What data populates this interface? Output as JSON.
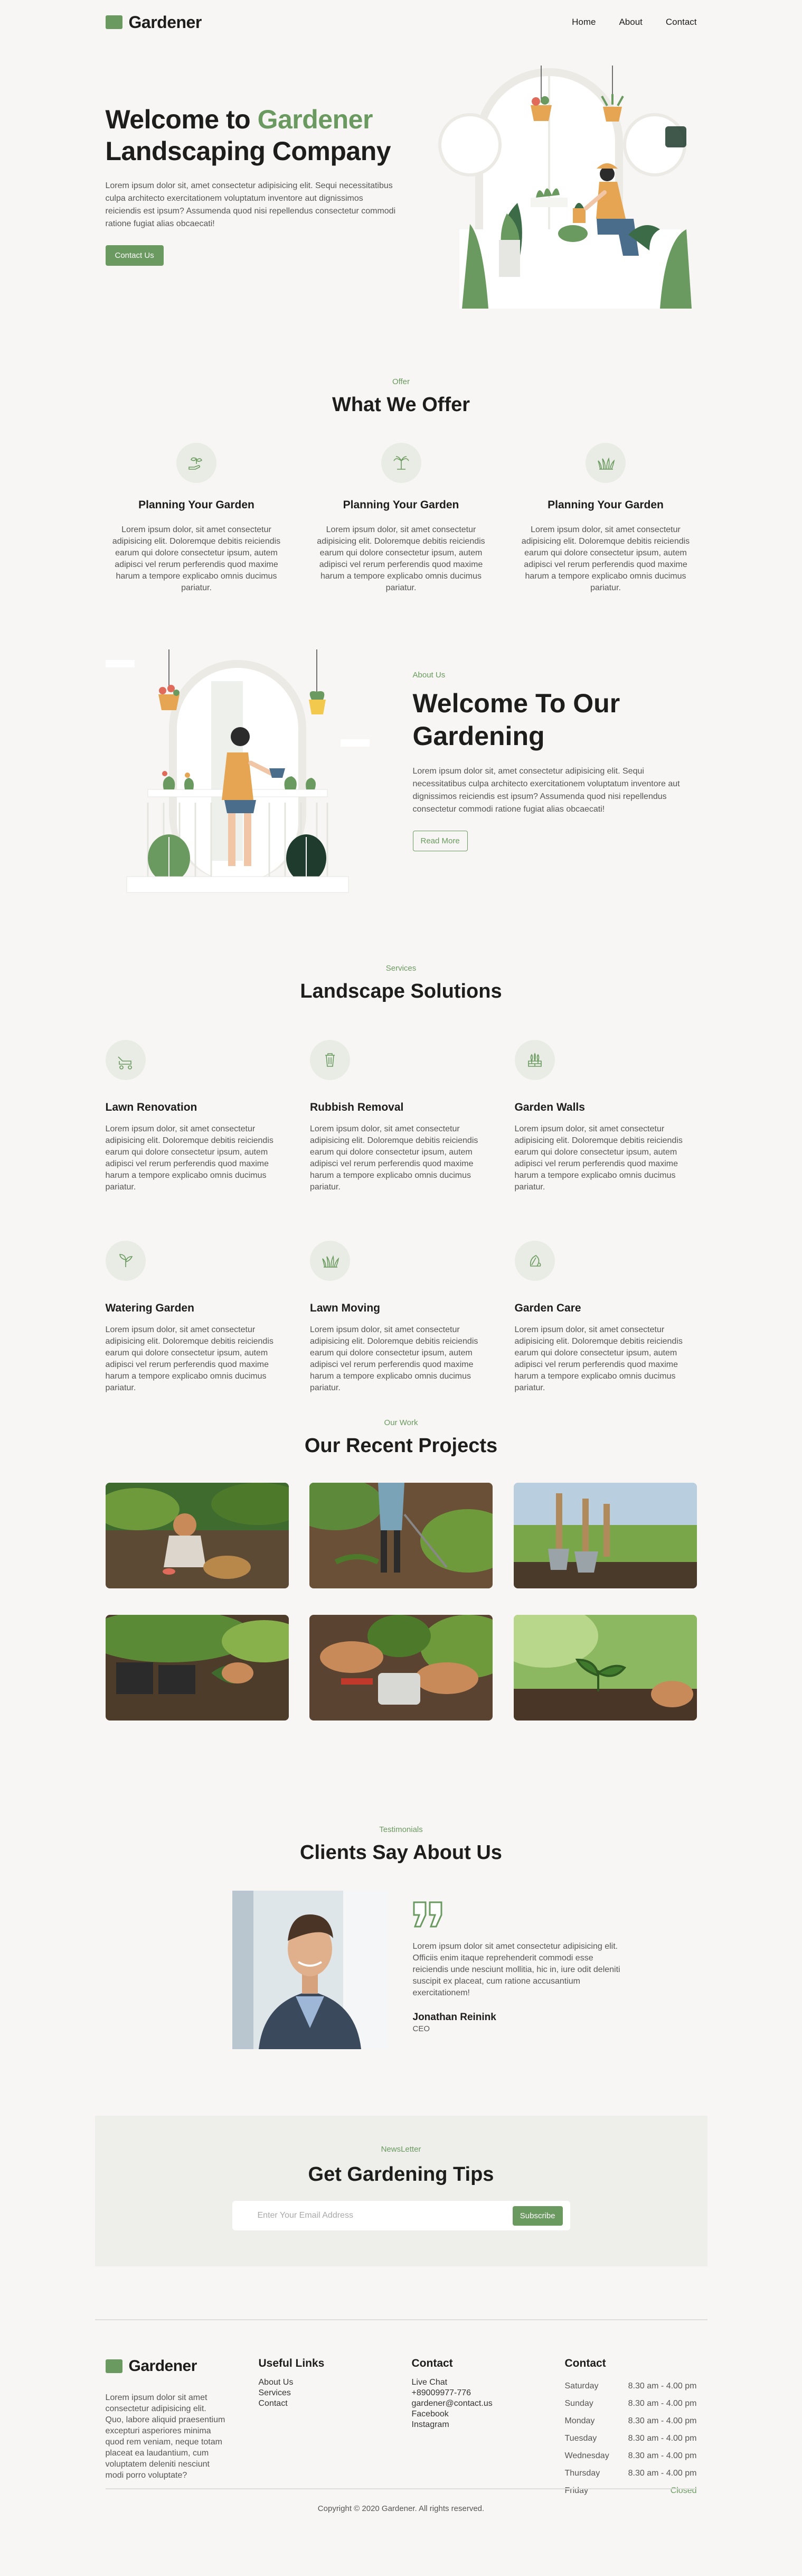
{
  "brand": {
    "name": "Gardener",
    "accent": "#6a9a5f"
  },
  "nav": {
    "items": [
      "Home",
      "About",
      "Contact"
    ]
  },
  "hero": {
    "title_pre": "Welcome to ",
    "title_accent": "Gardener",
    "title_post": "Landscaping Company",
    "text": "Lorem ipsum dolor sit, amet consectetur adipisicing elit. Sequi necessitatibus culpa architecto exercitationem voluptatum inventore aut dignissimos reiciendis est ipsum? Assumenda quod nisi repellendus consectetur commodi ratione fugiat alias obcaecati!",
    "cta": "Contact Us"
  },
  "offer": {
    "eyebrow": "Offer",
    "title": "What We Offer",
    "cards": [
      {
        "icon": "sprout-hand-icon",
        "title": "Planning Your Garden",
        "text": "Lorem ipsum dolor, sit amet consectetur adipisicing elit. Doloremque debitis reiciendis earum qui dolore consectetur ipsum, autem adipisci vel rerum perferendis quod maxime harum a tempore explicabo omnis ducimus pariatur."
      },
      {
        "icon": "palm-plant-icon",
        "title": "Planning Your Garden",
        "text": "Lorem ipsum dolor, sit amet consectetur adipisicing elit. Doloremque debitis reiciendis earum qui dolore consectetur ipsum, autem adipisci vel rerum perferendis quod maxime harum a tempore explicabo omnis ducimus pariatur."
      },
      {
        "icon": "grass-icon",
        "title": "Planning Your Garden",
        "text": "Lorem ipsum dolor, sit amet consectetur adipisicing elit. Doloremque debitis reiciendis earum qui dolore consectetur ipsum, autem adipisci vel rerum perferendis quod maxime harum a tempore explicabo omnis ducimus pariatur."
      }
    ]
  },
  "about": {
    "eyebrow": "About Us",
    "title": "Welcome To Our Gardening",
    "text": "Lorem ipsum dolor sit, amet consectetur adipisicing elit. Sequi necessitatibus culpa architecto exercitationem voluptatum inventore aut dignissimos reiciendis est ipsum? Assumenda quod nisi repellendus consectetur commodi ratione fugiat alias obcaecati!",
    "cta": "Read More"
  },
  "services": {
    "eyebrow": "Services",
    "title": "Landscape Solutions",
    "items": [
      {
        "icon": "lawn-mower-icon",
        "title": "Lawn Renovation",
        "text": "Lorem ipsum dolor, sit amet consectetur adipisicing elit. Doloremque debitis reiciendis earum qui dolore consectetur ipsum, autem adipisci vel rerum perferendis quod maxime harum a tempore explicabo omnis ducimus pariatur."
      },
      {
        "icon": "trash-bin-icon",
        "title": "Rubbish Removal",
        "text": "Lorem ipsum dolor, sit amet consectetur adipisicing elit. Doloremque debitis reiciendis earum qui dolore consectetur ipsum, autem adipisci vel rerum perferendis quod maxime harum a tempore explicabo omnis ducimus pariatur."
      },
      {
        "icon": "garden-wall-icon",
        "title": "Garden Walls",
        "text": "Lorem ipsum dolor, sit amet consectetur adipisicing elit. Doloremque debitis reiciendis earum qui dolore consectetur ipsum, autem adipisci vel rerum perferendis quod maxime harum a tempore explicabo omnis ducimus pariatur."
      },
      {
        "icon": "seedling-icon",
        "title": "Watering Garden",
        "text": "Lorem ipsum dolor, sit amet consectetur adipisicing elit. Doloremque debitis reiciendis earum qui dolore consectetur ipsum, autem adipisci vel rerum perferendis quod maxime harum a tempore explicabo omnis ducimus pariatur."
      },
      {
        "icon": "grass-icon",
        "title": "Lawn Moving",
        "text": "Lorem ipsum dolor, sit amet consectetur adipisicing elit. Doloremque debitis reiciendis earum qui dolore consectetur ipsum, autem adipisci vel rerum perferendis quod maxime harum a tempore explicabo omnis ducimus pariatur."
      },
      {
        "icon": "plant-leaf-icon",
        "title": "Garden Care",
        "text": "Lorem ipsum dolor, sit amet consectetur adipisicing elit. Doloremque debitis reiciendis earum qui dolore consectetur ipsum, autem adipisci vel rerum perferendis quod maxime harum a tempore explicabo omnis ducimus pariatur."
      }
    ]
  },
  "projects": {
    "eyebrow": "Our Work",
    "title": "Our Recent Projects",
    "photos": [
      "child-planting-photo",
      "gardener-raking-photo",
      "garden-tools-photo",
      "hands-planting-seedling-photo",
      "hands-holding-plant-photo",
      "sprout-soil-photo"
    ]
  },
  "testimonials": {
    "eyebrow": "Testimonials",
    "title": "Clients Say About Us",
    "quote": "Lorem ipsum dolor sit amet consectetur adipisicing elit. Officiis enim itaque reprehenderit commodi esse reiciendis unde nesciunt mollitia, hic in, iure odit deleniti suscipit ex placeat, cum ratione accusantium exercitationem!",
    "name": "Jonathan Reinink",
    "role": "CEO"
  },
  "newsletter": {
    "eyebrow": "NewsLetter",
    "title": "Get Gardening Tips",
    "placeholder": "Enter Your Email Address",
    "button": "Subscribe"
  },
  "footer": {
    "about_text": "Lorem ipsum dolor sit amet consectetur adipisicing elit. Quo, labore aliquid praesentium excepturi asperiores minima quod rem veniam, neque totam placeat ea laudantium, cum voluptatem deleniti nesciunt modi porro voluptate?",
    "links_title": "Useful Links",
    "links": [
      "About Us",
      "Services",
      "Contact"
    ],
    "contact_title": "Contact",
    "contact": [
      "Live Chat",
      "+89009977-776",
      "gardener@contact.us",
      "Facebook",
      "Instagram"
    ],
    "hours_title": "Contact",
    "hours": [
      {
        "day": "Saturday",
        "time": "8.30 am - 4.00 pm"
      },
      {
        "day": "Sunday",
        "time": "8.30 am - 4.00 pm"
      },
      {
        "day": "Monday",
        "time": "8.30 am - 4.00 pm"
      },
      {
        "day": "Tuesday",
        "time": "8.30 am - 4.00 pm"
      },
      {
        "day": "Wednesday",
        "time": "8.30 am - 4.00 pm"
      },
      {
        "day": "Thursday",
        "time": "8.30 am - 4.00 pm"
      },
      {
        "day": "Friday",
        "time": "Closed"
      }
    ],
    "copyright": "Copyright © 2020 Gardener. All rights reserved."
  }
}
